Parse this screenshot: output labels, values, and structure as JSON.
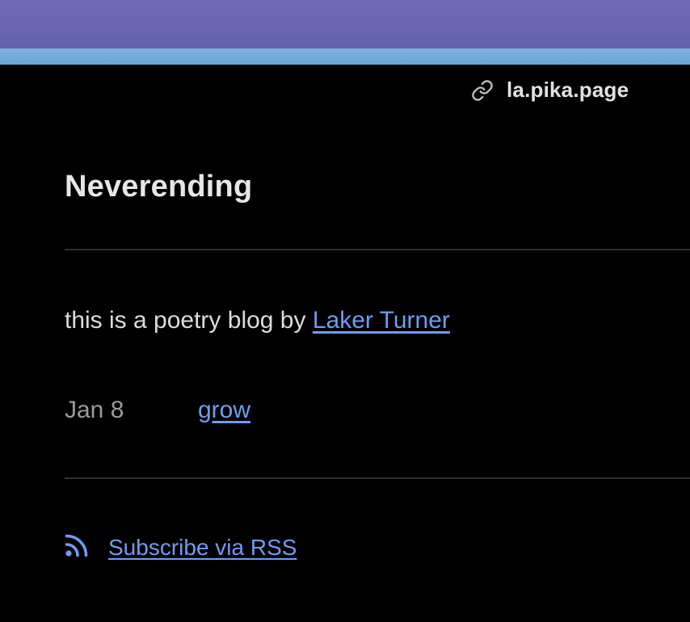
{
  "site": {
    "domain": "la.pika.page"
  },
  "blog": {
    "title": "Neverending",
    "description_prefix": "this is a poetry blog by ",
    "author_name": "Laker Turner"
  },
  "posts": [
    {
      "date": "Jan 8",
      "title": "grow"
    }
  ],
  "footer": {
    "rss_label": "Subscribe via RSS"
  },
  "colors": {
    "background": "#000000",
    "link": "#6f9cf2",
    "top_band": "#6864af",
    "top_strip": "#7aaedb"
  },
  "icons": {
    "site_link": "link-icon",
    "rss": "rss-icon"
  }
}
